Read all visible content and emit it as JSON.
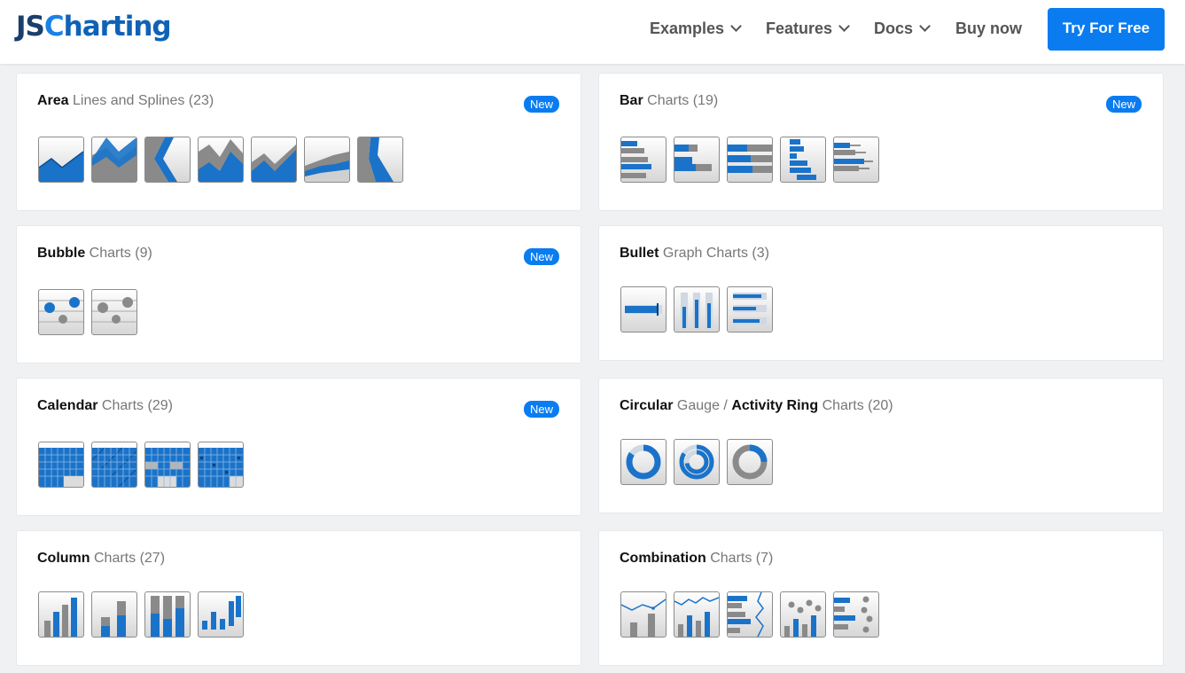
{
  "header": {
    "logo_js": "JS",
    "logo_c": "C",
    "logo_rest": "harting",
    "nav": [
      {
        "label": "Examples",
        "dropdown": true
      },
      {
        "label": "Features",
        "dropdown": true
      },
      {
        "label": "Docs",
        "dropdown": true
      },
      {
        "label": "Buy now",
        "dropdown": false
      }
    ],
    "cta": "Try For Free"
  },
  "colors": {
    "accent": "#0a7cf0",
    "thumb_blue": "#1a73c9",
    "thumb_gray": "#8a8a8a"
  },
  "cards": [
    {
      "bold": "Area",
      "rest": "Lines and Splines (23)",
      "badge": "New",
      "thumbs": [
        "area-chart-icon",
        "area-chart-icon",
        "area-chart-icon",
        "area-chart-icon",
        "area-chart-icon",
        "area-chart-icon",
        "area-chart-icon"
      ]
    },
    {
      "bold": "Bar",
      "rest": "Charts (19)",
      "badge": "New",
      "thumbs": [
        "bar-chart-icon",
        "bar-chart-icon",
        "bar-chart-icon",
        "bar-chart-icon",
        "bar-chart-icon"
      ]
    },
    {
      "bold": "Bubble",
      "rest": "Charts (9)",
      "badge": "New",
      "thumbs": [
        "bubble-chart-icon",
        "bubble-chart-icon"
      ]
    },
    {
      "bold": "Bullet",
      "rest": "Graph Charts (3)",
      "badge": "",
      "thumbs": [
        "bullet-chart-icon",
        "bullet-chart-icon",
        "bullet-chart-icon"
      ]
    },
    {
      "bold": "Calendar",
      "rest": "Charts (29)",
      "badge": "New",
      "thumbs": [
        "calendar-chart-icon",
        "calendar-chart-icon",
        "calendar-chart-icon",
        "calendar-chart-icon"
      ]
    },
    {
      "bold": "Circular",
      "rest": "Gauge /",
      "bold2": "Activity Ring",
      "rest2": "Charts (20)",
      "badge": "",
      "thumbs": [
        "gauge-chart-icon",
        "gauge-chart-icon",
        "gauge-chart-icon"
      ]
    },
    {
      "bold": "Column",
      "rest": "Charts (27)",
      "badge": "",
      "thumbs": [
        "column-chart-icon",
        "column-chart-icon",
        "column-chart-icon",
        "column-chart-icon"
      ]
    },
    {
      "bold": "Combination",
      "rest": "Charts (7)",
      "badge": "",
      "thumbs": [
        "combination-chart-icon",
        "combination-chart-icon",
        "combination-chart-icon",
        "combination-chart-icon",
        "combination-chart-icon"
      ]
    }
  ]
}
